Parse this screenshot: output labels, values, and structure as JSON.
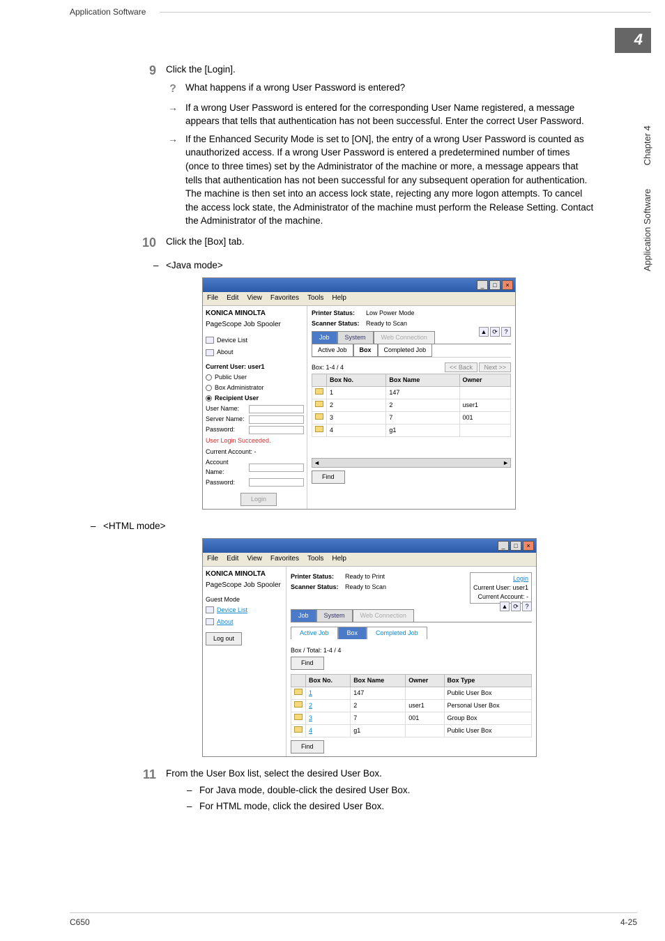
{
  "header": {
    "section": "Application Software"
  },
  "chapter_number": "4",
  "side": {
    "chapter_text": "Chapter 4",
    "section_text": "Application Software"
  },
  "steps": {
    "s9": {
      "num": "9",
      "text": "Click the [Login].",
      "question": "What happens if a wrong User Password is entered?",
      "answer1": "If a wrong User Password is entered for the corresponding User Name registered, a message appears that tells that authentication has not been successful. Enter the correct User Password.",
      "answer2": "If the Enhanced Security Mode is set to [ON], the entry of a wrong User Password is counted as unauthorized access. If a wrong User Password is entered a predetermined number of times (once to three times) set by the Administrator of the machine or more, a message appears that tells that authentication has not been successful for any subsequent operation for authentication. The machine is then set into an access lock state, rejecting any more logon attempts. To cancel the access lock state, the Administrator of the machine must perform the Release Setting. Contact the Administrator of the machine."
    },
    "s10": {
      "num": "10",
      "text": "Click the [Box] tab.",
      "java_label": "<Java mode>",
      "html_label": "<HTML mode>"
    },
    "s11": {
      "num": "11",
      "text": "From the User Box list, select the desired User Box.",
      "sub1": "For Java mode, double-click the desired User Box.",
      "sub2": "For HTML mode, click the desired User Box."
    }
  },
  "menus": {
    "file": "File",
    "edit": "Edit",
    "view": "View",
    "favorites": "Favorites",
    "tools": "Tools",
    "help": "Help"
  },
  "brand": "KONICA MINOLTA",
  "spooler": "PageScope Job Spooler",
  "nav": {
    "device_list": "Device List",
    "about": "About"
  },
  "java": {
    "current_user_label": "Current User: user1",
    "radios": {
      "public": "Public User",
      "boxadmin": "Box Administrator",
      "recipient": "Recipient User"
    },
    "form": {
      "user_name": "User Name:",
      "server_name": "Server Name:",
      "password": "Password:"
    },
    "login_status": "User Login Succeeded.",
    "account_label": "Current Account: -",
    "account_name": "Account Name:",
    "account_pw": "Password:",
    "login_btn": "Login",
    "printer_status_label": "Printer Status:",
    "printer_status_value": "Low Power Mode",
    "scanner_status_label": "Scanner Status:",
    "scanner_status_value": "Ready to Scan",
    "tabs1": {
      "job": "Job",
      "system": "System",
      "web": "Web Connection"
    },
    "tabs2": {
      "active": "Active Job",
      "box": "Box",
      "completed": "Completed Job"
    },
    "box_range": "Box: 1-4 / 4",
    "back": "<< Back",
    "next": "Next >>",
    "cols": {
      "no": "Box No.",
      "name": "Box Name",
      "owner": "Owner"
    },
    "rows": [
      {
        "no": "1",
        "name": "147",
        "owner": ""
      },
      {
        "no": "2",
        "name": "2",
        "owner": "user1"
      },
      {
        "no": "3",
        "name": "7",
        "owner": "001"
      },
      {
        "no": "4",
        "name": "g1",
        "owner": ""
      }
    ],
    "find": "Find"
  },
  "html": {
    "guest": "Guest Mode",
    "logout": "Log out",
    "printer_status_label": "Printer Status:",
    "printer_status_value": "Ready to Print",
    "scanner_status_label": "Scanner Status:",
    "scanner_status_value": "Ready to Scan",
    "login_link": "Login",
    "cur_user": "Current User: user1",
    "cur_acct": "Current Account: -",
    "tabs1": {
      "job": "Job",
      "system": "System",
      "web": "Web Connection"
    },
    "tabs2": {
      "active": "Active Job",
      "box": "Box",
      "completed": "Completed Job"
    },
    "total": "Box / Total: 1-4 / 4",
    "find": "Find",
    "cols": {
      "no": "Box No.",
      "name": "Box Name",
      "owner": "Owner",
      "type": "Box Type"
    },
    "rows": [
      {
        "no": "1",
        "name": "147",
        "owner": "",
        "type": "Public User Box"
      },
      {
        "no": "2",
        "name": "2",
        "owner": "user1",
        "type": "Personal User Box"
      },
      {
        "no": "3",
        "name": "7",
        "owner": "001",
        "type": "Group Box"
      },
      {
        "no": "4",
        "name": "g1",
        "owner": "",
        "type": "Public User Box"
      }
    ]
  },
  "footer": {
    "left": "C650",
    "right": "4-25"
  },
  "chart_data": null
}
